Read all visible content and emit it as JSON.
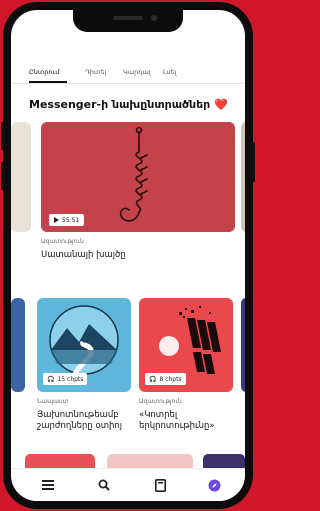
{
  "tabs": [
    {
      "label": "Ընտրում",
      "active": true
    },
    {
      "label": "Դիտել",
      "active": false
    },
    {
      "label": "Կարդալ",
      "active": false
    },
    {
      "label": "Լսել",
      "active": false
    }
  ],
  "section": {
    "title": "Messenger-ի նախընտրածներ",
    "heart": "❤️"
  },
  "hero": {
    "duration": "55:51",
    "category": "Ազատություն",
    "title": "Սատանայի խայծը",
    "color": "#c4434a"
  },
  "cards": [
    {
      "chapters": "15 chpts",
      "category": "Նապաստ",
      "title_line1": "Յախոտնութեամբ",
      "title_line2": "շարժողները օտիոյ",
      "color": "#5fb7dc"
    },
    {
      "chapters": "8 chpts",
      "category": "Ազատություն",
      "title_line1": "«Կոտրել",
      "title_line2": "երկրոտութիւնը»",
      "color": "#e9484c"
    }
  ],
  "bottom_nav": [
    "menu-icon",
    "search-icon",
    "book-icon",
    "compass-icon"
  ],
  "colors": {
    "accent_red": "#d0182a",
    "nav_active": "#6a4ad6"
  }
}
